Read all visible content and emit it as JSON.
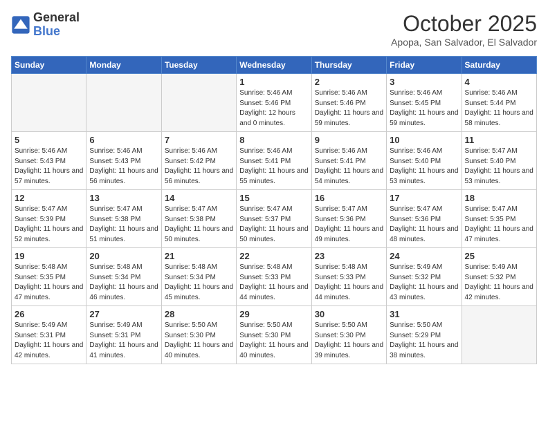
{
  "header": {
    "logo_general": "General",
    "logo_blue": "Blue",
    "month_title": "October 2025",
    "location": "Apopa, San Salvador, El Salvador"
  },
  "days_of_week": [
    "Sunday",
    "Monday",
    "Tuesday",
    "Wednesday",
    "Thursday",
    "Friday",
    "Saturday"
  ],
  "weeks": [
    [
      {
        "day": "",
        "empty": true
      },
      {
        "day": "",
        "empty": true
      },
      {
        "day": "",
        "empty": true
      },
      {
        "day": "1",
        "sunrise": "5:46 AM",
        "sunset": "5:46 PM",
        "daylight": "12 hours and 0 minutes."
      },
      {
        "day": "2",
        "sunrise": "5:46 AM",
        "sunset": "5:46 PM",
        "daylight": "11 hours and 59 minutes."
      },
      {
        "day": "3",
        "sunrise": "5:46 AM",
        "sunset": "5:45 PM",
        "daylight": "11 hours and 59 minutes."
      },
      {
        "day": "4",
        "sunrise": "5:46 AM",
        "sunset": "5:44 PM",
        "daylight": "11 hours and 58 minutes."
      }
    ],
    [
      {
        "day": "5",
        "sunrise": "5:46 AM",
        "sunset": "5:43 PM",
        "daylight": "11 hours and 57 minutes."
      },
      {
        "day": "6",
        "sunrise": "5:46 AM",
        "sunset": "5:43 PM",
        "daylight": "11 hours and 56 minutes."
      },
      {
        "day": "7",
        "sunrise": "5:46 AM",
        "sunset": "5:42 PM",
        "daylight": "11 hours and 56 minutes."
      },
      {
        "day": "8",
        "sunrise": "5:46 AM",
        "sunset": "5:41 PM",
        "daylight": "11 hours and 55 minutes."
      },
      {
        "day": "9",
        "sunrise": "5:46 AM",
        "sunset": "5:41 PM",
        "daylight": "11 hours and 54 minutes."
      },
      {
        "day": "10",
        "sunrise": "5:46 AM",
        "sunset": "5:40 PM",
        "daylight": "11 hours and 53 minutes."
      },
      {
        "day": "11",
        "sunrise": "5:47 AM",
        "sunset": "5:40 PM",
        "daylight": "11 hours and 53 minutes."
      }
    ],
    [
      {
        "day": "12",
        "sunrise": "5:47 AM",
        "sunset": "5:39 PM",
        "daylight": "11 hours and 52 minutes."
      },
      {
        "day": "13",
        "sunrise": "5:47 AM",
        "sunset": "5:38 PM",
        "daylight": "11 hours and 51 minutes."
      },
      {
        "day": "14",
        "sunrise": "5:47 AM",
        "sunset": "5:38 PM",
        "daylight": "11 hours and 50 minutes."
      },
      {
        "day": "15",
        "sunrise": "5:47 AM",
        "sunset": "5:37 PM",
        "daylight": "11 hours and 50 minutes."
      },
      {
        "day": "16",
        "sunrise": "5:47 AM",
        "sunset": "5:36 PM",
        "daylight": "11 hours and 49 minutes."
      },
      {
        "day": "17",
        "sunrise": "5:47 AM",
        "sunset": "5:36 PM",
        "daylight": "11 hours and 48 minutes."
      },
      {
        "day": "18",
        "sunrise": "5:47 AM",
        "sunset": "5:35 PM",
        "daylight": "11 hours and 47 minutes."
      }
    ],
    [
      {
        "day": "19",
        "sunrise": "5:48 AM",
        "sunset": "5:35 PM",
        "daylight": "11 hours and 47 minutes."
      },
      {
        "day": "20",
        "sunrise": "5:48 AM",
        "sunset": "5:34 PM",
        "daylight": "11 hours and 46 minutes."
      },
      {
        "day": "21",
        "sunrise": "5:48 AM",
        "sunset": "5:34 PM",
        "daylight": "11 hours and 45 minutes."
      },
      {
        "day": "22",
        "sunrise": "5:48 AM",
        "sunset": "5:33 PM",
        "daylight": "11 hours and 44 minutes."
      },
      {
        "day": "23",
        "sunrise": "5:48 AM",
        "sunset": "5:33 PM",
        "daylight": "11 hours and 44 minutes."
      },
      {
        "day": "24",
        "sunrise": "5:49 AM",
        "sunset": "5:32 PM",
        "daylight": "11 hours and 43 minutes."
      },
      {
        "day": "25",
        "sunrise": "5:49 AM",
        "sunset": "5:32 PM",
        "daylight": "11 hours and 42 minutes."
      }
    ],
    [
      {
        "day": "26",
        "sunrise": "5:49 AM",
        "sunset": "5:31 PM",
        "daylight": "11 hours and 42 minutes."
      },
      {
        "day": "27",
        "sunrise": "5:49 AM",
        "sunset": "5:31 PM",
        "daylight": "11 hours and 41 minutes."
      },
      {
        "day": "28",
        "sunrise": "5:50 AM",
        "sunset": "5:30 PM",
        "daylight": "11 hours and 40 minutes."
      },
      {
        "day": "29",
        "sunrise": "5:50 AM",
        "sunset": "5:30 PM",
        "daylight": "11 hours and 40 minutes."
      },
      {
        "day": "30",
        "sunrise": "5:50 AM",
        "sunset": "5:30 PM",
        "daylight": "11 hours and 39 minutes."
      },
      {
        "day": "31",
        "sunrise": "5:50 AM",
        "sunset": "5:29 PM",
        "daylight": "11 hours and 38 minutes."
      },
      {
        "day": "",
        "empty": true
      }
    ]
  ]
}
